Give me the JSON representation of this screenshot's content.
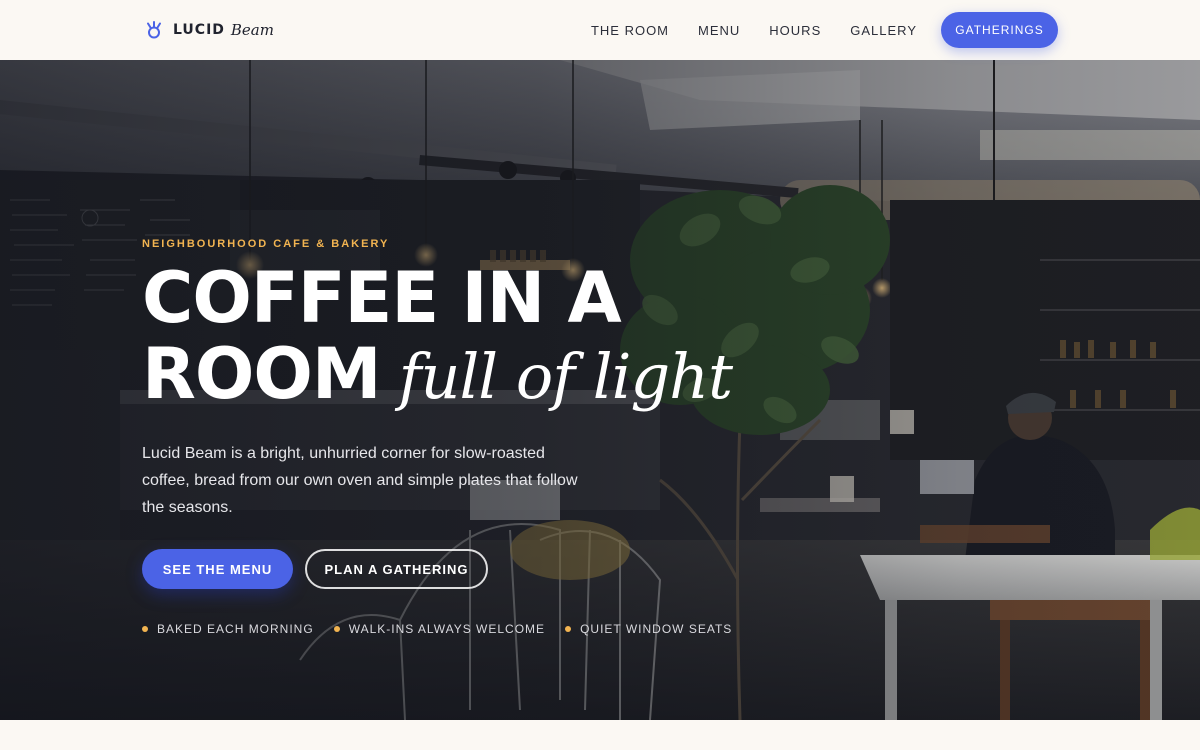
{
  "brand": {
    "name": "LUCID",
    "name_suffix": "Beam",
    "icon": "sprout-icon",
    "accent_color": "#4b63e6"
  },
  "nav": {
    "links": [
      "THE ROOM",
      "MENU",
      "HOURS",
      "GALLERY"
    ],
    "cta_label": "GATHERINGS"
  },
  "hero": {
    "eyebrow": "NEIGHBOURHOOD CAFE & BAKERY",
    "headline_line1": "COFFEE IN A",
    "headline_line2": "ROOM",
    "headline_accent": "full of light",
    "lede": "Lucid Beam is a bright, unhurried corner for slow-roasted coffee, bread from our own oven and simple plates that follow the seasons.",
    "primary_button": "SEE THE MENU",
    "secondary_button": "PLAN A GATHERING",
    "features": [
      "BAKED EACH MORNING",
      "WALK-INS ALWAYS WELCOME",
      "QUIET WINDOW SEATS"
    ],
    "eyebrow_color": "#f2b451",
    "background_image": "cafe-interior-photo"
  }
}
